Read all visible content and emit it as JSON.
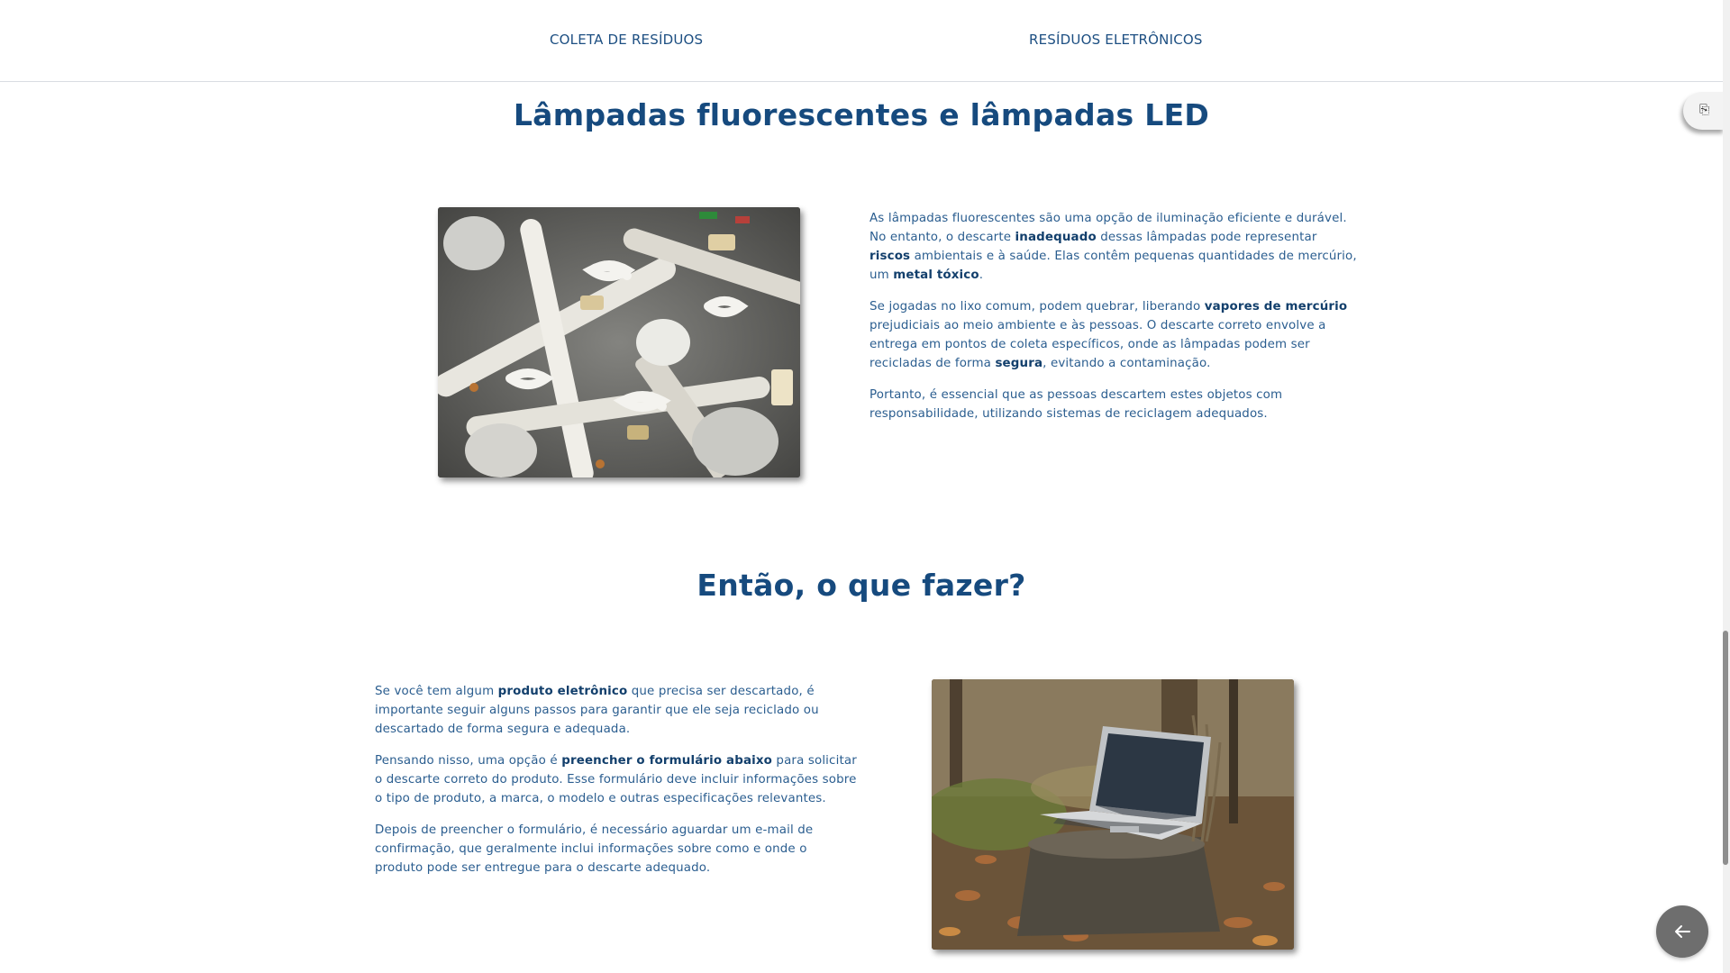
{
  "nav": {
    "items": [
      {
        "label": "COLETA DE RESÍDUOS"
      },
      {
        "label": "RESÍDUOS ELETRÔNICOS"
      }
    ]
  },
  "section1": {
    "title": "Lâmpadas fluorescentes e lâmpadas LED",
    "image_subject": "pile of used fluorescent and LED lamps",
    "paragraphs": [
      {
        "parts": [
          {
            "text": "As lâmpadas fluorescentes são uma opção de iluminação eficiente e durável. No entanto, o descarte ",
            "bold": false
          },
          {
            "text": "inadequado",
            "bold": true
          },
          {
            "text": " dessas lâmpadas pode representar ",
            "bold": false
          },
          {
            "text": "riscos",
            "bold": true
          },
          {
            "text": " ambientais e à saúde. Elas contêm pequenas quantidades de mercúrio, um ",
            "bold": false
          },
          {
            "text": "metal tóxico",
            "bold": true
          },
          {
            "text": ".",
            "bold": false
          }
        ]
      },
      {
        "parts": [
          {
            "text": "Se jogadas no lixo comum, podem quebrar, liberando ",
            "bold": false
          },
          {
            "text": "vapores de mercúrio",
            "bold": true
          },
          {
            "text": " prejudiciais ao meio ambiente e às pessoas. O descarte correto envolve a entrega em pontos de coleta específicos, onde as lâmpadas podem ser recicladas de forma ",
            "bold": false
          },
          {
            "text": "segura",
            "bold": true
          },
          {
            "text": ", evitando a contaminação.",
            "bold": false
          }
        ]
      },
      {
        "parts": [
          {
            "text": "Portanto, é essencial que as pessoas descartem estes objetos com responsabilidade, utilizando sistemas de reciclagem adequados.",
            "bold": false
          }
        ]
      }
    ]
  },
  "section2": {
    "title": "Então, o que fazer?",
    "image_subject": "laptop on a tree stump among autumn leaves",
    "paragraphs": [
      {
        "parts": [
          {
            "text": "Se você tem algum ",
            "bold": false
          },
          {
            "text": "produto eletrônico",
            "bold": true
          },
          {
            "text": " que precisa ser descartado, é importante seguir alguns passos para garantir que ele seja reciclado ou descartado de forma segura e adequada.",
            "bold": false
          }
        ]
      },
      {
        "parts": [
          {
            "text": "Pensando nisso, uma opção é ",
            "bold": false
          },
          {
            "text": "preencher o formulário abaixo",
            "bold": true
          },
          {
            "text": " para solicitar o descarte correto do produto. Esse formulário deve incluir informações sobre o tipo de produto, a marca, o modelo e outras especificações relevantes.",
            "bold": false
          }
        ]
      },
      {
        "parts": [
          {
            "text": "Depois de preencher o formulário, é necessário aguardar um e-mail de confirmação, que geralmente inclui informações sobre como e onde o produto pode ser entregue para o descarte adequado.",
            "bold": false
          }
        ]
      }
    ]
  },
  "icons": {
    "side_tab": "translate-icon",
    "back_button": "arrow-left-icon"
  },
  "colors": {
    "heading": "#164a7e",
    "body_text": "#2a5d8f",
    "nav_link": "#1d4f82",
    "back_button": "#6e6e6e"
  }
}
